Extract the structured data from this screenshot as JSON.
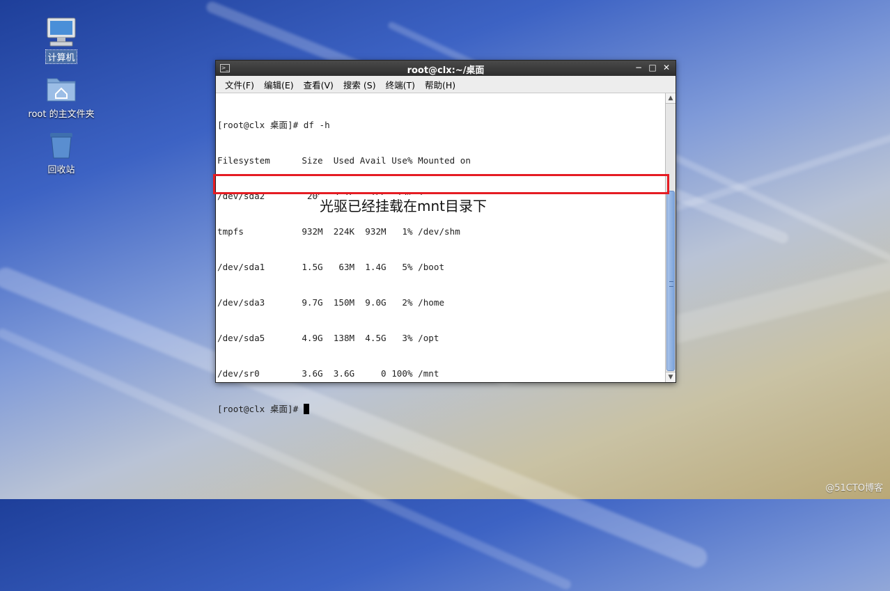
{
  "desktop": {
    "icons": [
      {
        "label": "计算机",
        "icon": "computer-icon"
      },
      {
        "label": "root 的主文件夹",
        "icon": "home-folder-icon"
      },
      {
        "label": "回收站",
        "icon": "trash-icon"
      }
    ]
  },
  "window": {
    "title": "root@clx:~/桌面",
    "icon": "terminal-icon",
    "controls": {
      "minimize": "−",
      "maximize": "□",
      "close": "✕"
    },
    "menu": [
      "文件(F)",
      "编辑(E)",
      "查看(V)",
      "搜索 (S)",
      "终端(T)",
      "帮助(H)"
    ]
  },
  "terminal": {
    "lines": [
      "[root@clx 桌面]# df -h",
      "Filesystem      Size  Used Avail Use% Mounted on",
      "/dev/sda2        20G  3.1G   16G  17% /",
      "tmpfs           932M  224K  932M   1% /dev/shm",
      "/dev/sda1       1.5G   63M  1.4G   5% /boot",
      "/dev/sda3       9.7G  150M  9.0G   2% /home",
      "/dev/sda5       4.9G  138M  4.5G   3% /opt",
      "/dev/sr0        3.6G  3.6G     0 100% /mnt"
    ],
    "prompt": "[root@clx 桌面]# "
  },
  "annotation": {
    "text": "光驱已经挂载在mnt目录下",
    "border_color": "#e51c23"
  },
  "watermark": "@51CTO博客"
}
